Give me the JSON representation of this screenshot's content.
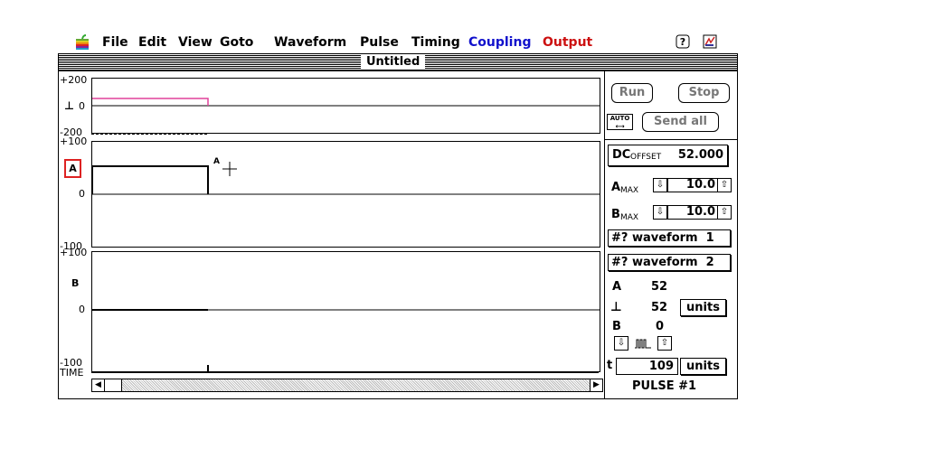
{
  "menubar": {
    "items": [
      "File",
      "Edit",
      "View",
      "Goto",
      "Waveform",
      "Pulse",
      "Timing",
      "Coupling",
      "Output"
    ],
    "colors": {
      "Coupling": "#1111cc",
      "Output": "#cc1111"
    },
    "right_icons": [
      "help-icon",
      "app-icon"
    ]
  },
  "window": {
    "title": "Untitled"
  },
  "plots": {
    "top": {
      "ymax": "+200",
      "yzero": "0",
      "ymin": "-200",
      "marker": "⊥"
    },
    "a": {
      "ymax": "+100",
      "yzero": "0",
      "ymin": "-100",
      "name": "A",
      "cursor_label": "A"
    },
    "b": {
      "ymax": "+100",
      "yzero": "0",
      "ymin": "-100",
      "name": "B"
    },
    "time_label": "TIME"
  },
  "controls": {
    "run": "Run",
    "stop": "Stop",
    "auto": "AUTO",
    "send_all": "Send all",
    "dc_label": "DC",
    "dc_sub": "OFFSET",
    "dc_value": "52.000",
    "amax_label": "A",
    "amax_sub": "MAX",
    "amax_value": "10.0",
    "bmax_label": "B",
    "bmax_sub": "MAX",
    "bmax_value": "10.0",
    "waveform1": "#? waveform  1",
    "waveform2": "#? waveform  2",
    "a_label": "A",
    "a_value": "52",
    "t_marker": "⊥",
    "t_value": "52",
    "units1": "units",
    "b_label": "B",
    "b_value": "0",
    "t_label": "t",
    "t_time": "109",
    "units2": "units",
    "pulse": "PULSE #1"
  }
}
